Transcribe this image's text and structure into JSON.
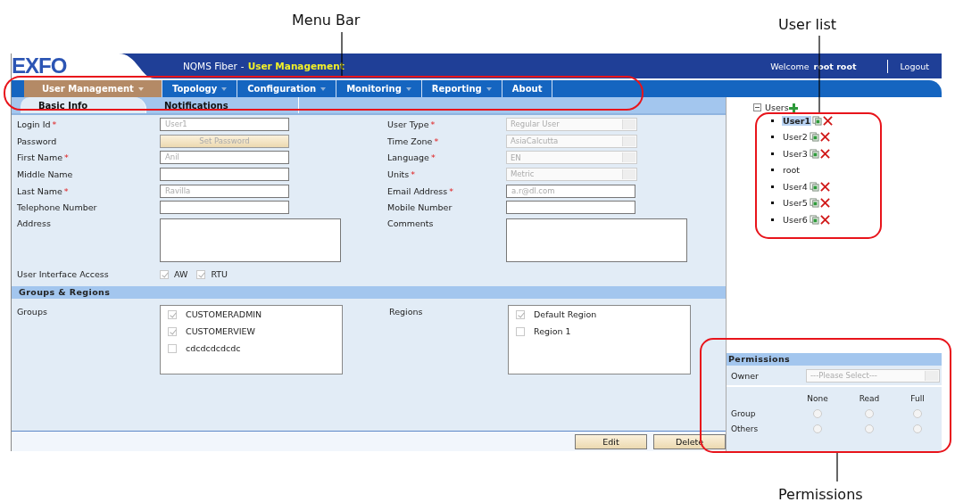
{
  "annotations": [
    {
      "label": "Menu Bar"
    },
    {
      "label": "User list"
    },
    {
      "label": "Permissions"
    }
  ],
  "header": {
    "logo": "EXFO",
    "app_name": "NQMS Fiber",
    "separator": "-",
    "page": "User Management",
    "welcome": "Welcome",
    "user": "root root",
    "logout": "Logout"
  },
  "menu": [
    {
      "label": "User Management",
      "dropdown": true,
      "selected": true
    },
    {
      "label": "Topology",
      "dropdown": true,
      "selected": false
    },
    {
      "label": "Configuration",
      "dropdown": true,
      "selected": false
    },
    {
      "label": "Monitoring",
      "dropdown": true,
      "selected": false
    },
    {
      "label": "Reporting",
      "dropdown": true,
      "selected": false
    },
    {
      "label": "About",
      "dropdown": false,
      "selected": false
    }
  ],
  "tabs": [
    {
      "label": "Basic Info",
      "selected": true
    },
    {
      "label": "Notifications",
      "selected": false
    }
  ],
  "form_rows": [
    {
      "left": {
        "label": "Login Id",
        "required_mark": "*",
        "kind": "text",
        "value": "User1"
      },
      "right": {
        "label": "User Type",
        "required_mark": "*",
        "kind": "select",
        "value": "Regular User"
      }
    },
    {
      "left": {
        "label": "Password",
        "kind": "button",
        "value": "Set Password"
      },
      "right": {
        "label": "Time Zone",
        "required_mark": "*",
        "kind": "select",
        "value": "AsiaCalcutta"
      }
    },
    {
      "left": {
        "label": "First Name",
        "required_mark": "*",
        "kind": "text",
        "value": "Anil"
      },
      "right": {
        "label": "Language",
        "required_mark": "*",
        "kind": "select",
        "value": "EN"
      }
    },
    {
      "left": {
        "label": "Middle Name",
        "kind": "text"
      },
      "right": {
        "label": "Units",
        "required_mark": "*",
        "kind": "select",
        "value": "Metric"
      }
    },
    {
      "left": {
        "label": "Last Name",
        "required_mark": "*",
        "kind": "text",
        "value": "Ravilla"
      },
      "right": {
        "label": "Email Address",
        "required_mark": "*",
        "kind": "text",
        "value": "a.r@dl.com"
      }
    },
    {
      "left": {
        "label": "Telephone Number",
        "kind": "text"
      },
      "right": {
        "label": "Mobile Number",
        "kind": "text"
      }
    },
    {
      "left": {
        "label": "Address",
        "kind": "textarea"
      },
      "right": {
        "label": "Comments",
        "kind": "textarea"
      }
    }
  ],
  "ui_access": {
    "label": "User Interface Access",
    "options": [
      {
        "label": "AW",
        "checked": true
      },
      {
        "label": "RTU",
        "checked": true
      }
    ]
  },
  "groups_section": {
    "title": "Groups & Regions",
    "groups": {
      "label": "Groups",
      "items": [
        {
          "label": "CUSTOMERADMIN",
          "checked": true
        },
        {
          "label": "CUSTOMERVIEW",
          "checked": true
        },
        {
          "label": "cdcdcdcdcdc",
          "checked": false
        }
      ]
    },
    "regions": {
      "label": "Regions",
      "items": [
        {
          "label": "Default Region",
          "checked": true
        },
        {
          "label": "Region 1",
          "checked": false
        }
      ]
    }
  },
  "buttons": [
    "Edit",
    "Delete"
  ],
  "user_tree": {
    "label": "Users",
    "expanded": true,
    "children": [
      {
        "label": "User1",
        "selected": true,
        "actions": true
      },
      {
        "label": "User2",
        "selected": false,
        "actions": true
      },
      {
        "label": "User3",
        "selected": false,
        "actions": true
      },
      {
        "label": "root",
        "selected": false,
        "actions": false
      },
      {
        "label": "User4",
        "selected": false,
        "actions": true
      },
      {
        "label": "User5",
        "selected": false,
        "actions": true
      },
      {
        "label": "User6",
        "selected": false,
        "actions": true
      }
    ]
  },
  "permissions": {
    "title": "Permissions",
    "owner_label": "Owner",
    "owner_placeholder": "---Please Select---",
    "columns": [
      "None",
      "Read",
      "Full"
    ],
    "rows": [
      {
        "label": "Group",
        "options": [
          {
            "selected": false
          },
          {
            "selected": false
          },
          {
            "selected": false
          }
        ]
      },
      {
        "label": "Others",
        "options": [
          {
            "selected": false
          },
          {
            "selected": false
          },
          {
            "selected": false
          }
        ]
      }
    ]
  }
}
